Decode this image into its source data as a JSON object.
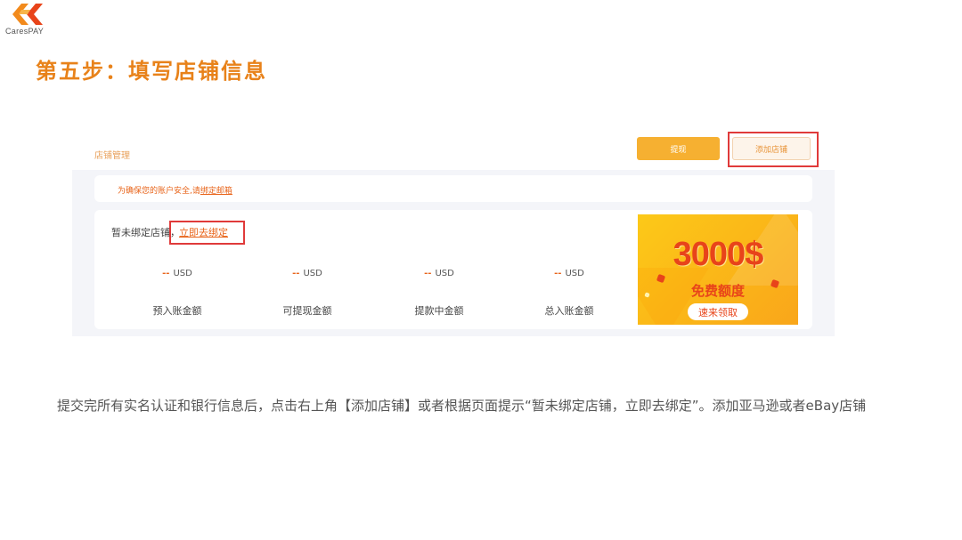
{
  "logo": {
    "text": "CaresPAY",
    "colors": [
      "#f28a1c",
      "#e8441a"
    ]
  },
  "slide": {
    "title": "第五步：填写店铺信息",
    "caption": "提交完所有实名认证和银行信息后，点击右上角【添加店铺】或者根据页面提示“暂未绑定店铺，立即去绑定”。添加亚马逊或者eBay店铺"
  },
  "store_page": {
    "section_title": "店铺管理",
    "withdraw_label": "提现",
    "add_store_label": "添加店铺",
    "notice_prefix": "为确保您的账户安全,请",
    "notice_link": "绑定邮箱",
    "unbound_text": "暂未绑定店铺，",
    "bind_link": "立即去绑定",
    "stats": [
      {
        "value": "--",
        "currency": "USD",
        "label": "预入账金额"
      },
      {
        "value": "--",
        "currency": "USD",
        "label": "可提现金额"
      },
      {
        "value": "--",
        "currency": "USD",
        "label": "提款中金额"
      },
      {
        "value": "--",
        "currency": "USD",
        "label": "总入账金额"
      }
    ],
    "promo": {
      "amount": "3000$",
      "subtitle": "免费额度",
      "button_label": "速来领取"
    }
  },
  "colors": {
    "title": "#e8821a",
    "accent": "#e8641a",
    "withdraw_button": "#f6b031",
    "highlight": "#e03a3a",
    "promo_bg": "#fbb918"
  }
}
